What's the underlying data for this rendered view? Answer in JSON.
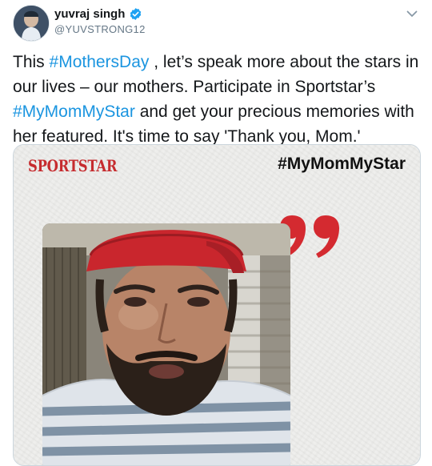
{
  "user": {
    "display_name": "yuvraj singh",
    "handle": "@YUVSTRONG12"
  },
  "icons": {
    "verified": "verified-badge-icon",
    "menu": "chevron-down-icon"
  },
  "tweet": {
    "t1": "This ",
    "tag1": "#MothersDay",
    "t2": " , let’s speak more about the stars in our lives – our mothers. Participate in Sportstar’s ",
    "tag2": "#MyMomMyStar",
    "t3": " and get your precious memories with her featured. It's time to say 'Thank you, Mom.'"
  },
  "media": {
    "brand": "SPORTSTAR",
    "hashtag": "#MyMomMyStar"
  },
  "colors": {
    "link": "#1b95e0",
    "brand_red": "#c62c2f",
    "verified_blue": "#1da1f2",
    "cap_red": "#c9262d"
  }
}
